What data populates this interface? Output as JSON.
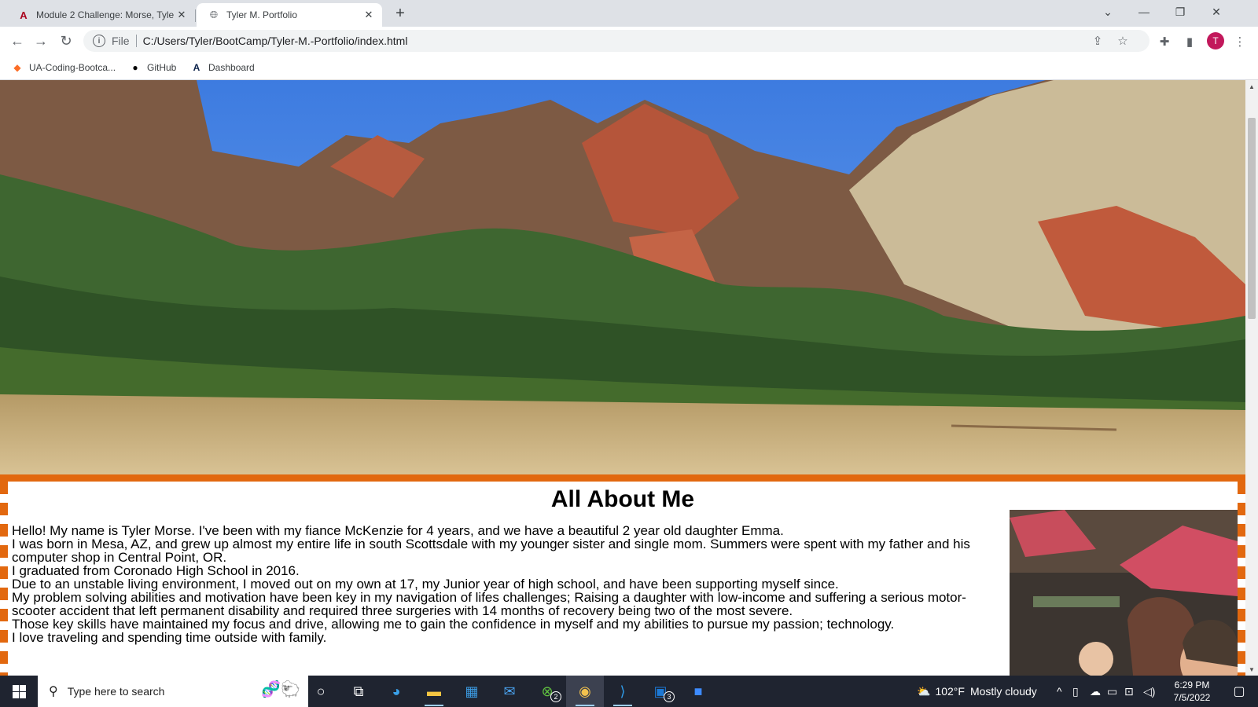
{
  "browser": {
    "tabs": [
      {
        "title": "Module 2 Challenge: Morse, Tyle",
        "favicon": "arizona-a-icon",
        "active": false
      },
      {
        "title": "Tyler M. Portfolio",
        "favicon": "globe-icon",
        "active": true
      }
    ],
    "address": {
      "protocol_label": "File",
      "url": "C:/Users/Tyler/BootCamp/Tyler-M.-Portfolio/index.html"
    },
    "profile_initial": "T",
    "bookmarks": [
      {
        "label": "UA-Coding-Bootca...",
        "icon": "gitlab-icon"
      },
      {
        "label": "GitHub",
        "icon": "github-icon"
      },
      {
        "label": "Dashboard",
        "icon": "arizona-a-icon"
      }
    ]
  },
  "page": {
    "about_heading": "All About Me",
    "bio_lines": [
      "Hello! My name is Tyler Morse. I've been with my fiance McKenzie for 4 years, and we have a beautiful 2 year old daughter Emma.",
      "I was born in Mesa, AZ, and grew up almost my entire life in south Scottsdale with my younger sister and single mom. Summers were spent with my father and his computer shop in Central Point, OR.",
      "I graduated from Coronado High School in 2016.",
      "Due to an unstable living environment, I moved out on my own at 17, my Junior year of high school, and have been supporting myself since.",
      "My problem solving abilities and motivation have been key in my navigation of lifes challenges; Raising a daughter with low-income and suffering a serious motor-scooter accident that left permanent disability and required three surgeries with 14 months of recovery being two of the most severe.",
      "Those key skills have maintained my focus and drive, allowing me to gain the confidence in myself and my abilities to pursue my passion; technology.",
      "I love traveling and spending time outside with family."
    ],
    "accent_color": "#e2680f"
  },
  "taskbar": {
    "search_placeholder": "Type here to search",
    "weather": {
      "temp": "102°F",
      "condition": "Mostly cloudy"
    },
    "time": "6:29 PM",
    "date": "7/5/2022",
    "xbox_badge": "2",
    "outlook_badge": "3"
  }
}
